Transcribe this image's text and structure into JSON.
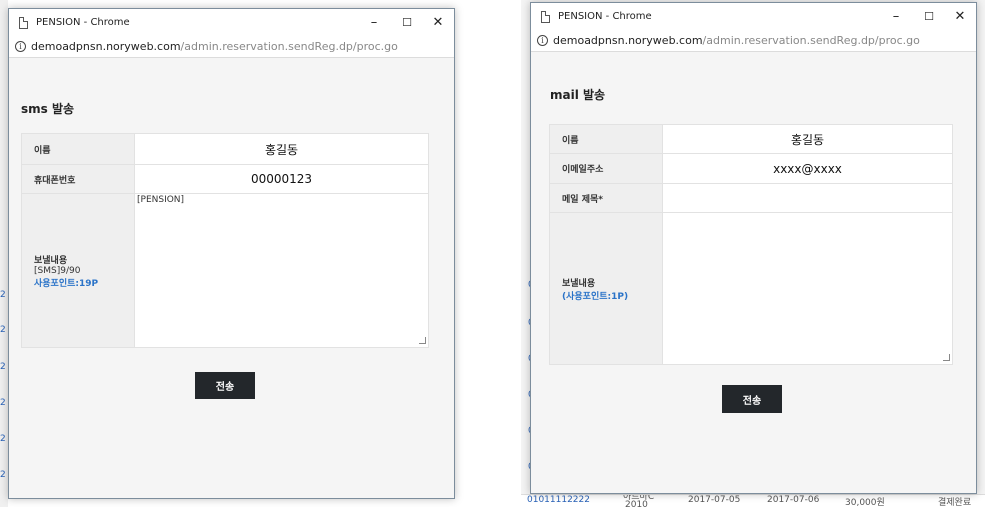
{
  "background": {
    "left_link_glyph": "2",
    "right_link_glyph": "0",
    "bottom_row": [
      "01011112222",
      "아트바C",
      "2017-07-05",
      "2017-07-06",
      "30,000원",
      "결제완료"
    ],
    "bottom_row_sub": "2010"
  },
  "sms_window": {
    "title": "PENSION - Chrome",
    "url_host": "demoadpnsn.noryweb.com",
    "url_path": "/admin.reservation.sendReg.dp/proc.go",
    "heading": "sms 발송",
    "rows": {
      "name_label": "이름",
      "name_value": "홍길동",
      "phone_label": "휴대폰번호",
      "phone_value": "00000123",
      "content_label_1": "보낼내용",
      "content_label_2": "[SMS]9/90",
      "content_label_3": "사용포인트:19P",
      "content_value": "[PENSION]"
    },
    "send_label": "전송"
  },
  "mail_window": {
    "title": "PENSION - Chrome",
    "url_host": "demoadpnsn.noryweb.com",
    "url_path": "/admin.reservation.sendReg.dp/proc.go",
    "heading": "mail 발송",
    "rows": {
      "name_label": "이름",
      "name_value": "홍길동",
      "email_label": "이메일주소",
      "email_value": "xxxx@xxxx",
      "subject_label": "메일 제목*",
      "subject_value": "",
      "content_label_1": "보낼내용",
      "content_label_2": "(사용포인트:1P)",
      "content_value": ""
    },
    "send_label": "전송"
  },
  "window_controls": {
    "minimize": "–",
    "maximize": "☐",
    "close": "✕"
  },
  "icons": {
    "info": "i"
  }
}
